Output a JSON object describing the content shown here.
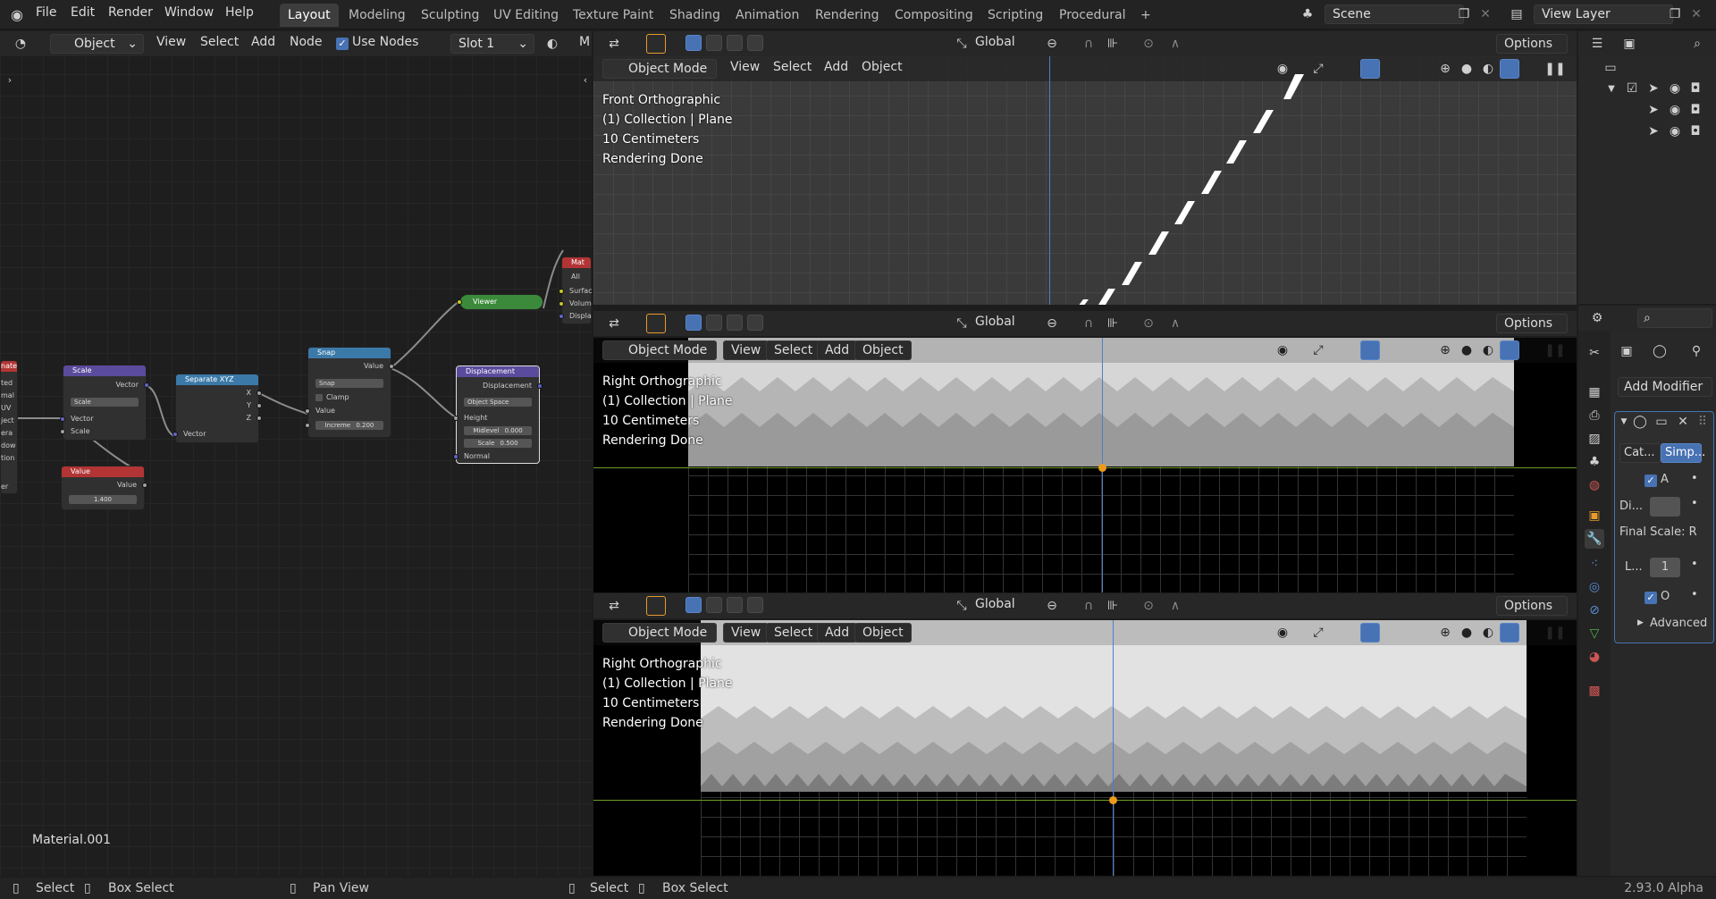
{
  "menus": [
    "File",
    "Edit",
    "Render",
    "Window",
    "Help"
  ],
  "workspaces": [
    "Layout",
    "Modeling",
    "Sculpting",
    "UV Editing",
    "Texture Paint",
    "Shading",
    "Animation",
    "Rendering",
    "Compositing",
    "Scripting",
    "Procedural"
  ],
  "add_workspace": "+",
  "scene": "Scene",
  "view_layer": "View Layer",
  "node_editor": {
    "object_dropdown": "Object",
    "menus": [
      "View",
      "Select",
      "Add",
      "Node"
    ],
    "use_nodes_label": "Use Nodes",
    "slot": "Slot 1",
    "material_name": "Material.001",
    "nodes": {
      "scale": {
        "title": "Scale",
        "out": "Vector",
        "mode": "Scale",
        "in1": "Vector",
        "in2": "Scale"
      },
      "value": {
        "title": "Value",
        "out": "Value",
        "val": "1.400"
      },
      "separate": {
        "title": "Separate XYZ",
        "x": "X",
        "y": "Y",
        "z": "Z",
        "in": "Vector"
      },
      "snap": {
        "title": "Snap",
        "out": "Value",
        "mode": "Snap",
        "clamp": "Clamp",
        "in": "Value",
        "increment_label": "Increme",
        "increment": "0.200"
      },
      "viewer": {
        "title": "Viewer"
      },
      "displacement": {
        "title": "Displacement",
        "out": "Displacement",
        "space": "Object Space",
        "height": "Height",
        "midlevel_label": "Midlevel",
        "midlevel": "0.000",
        "scale_label": "Scale",
        "scale": "0.500",
        "normal": "Normal"
      },
      "material_output": {
        "title": "Mat",
        "all": "All",
        "surface": "Surfac",
        "volume": "Volum",
        "displacement": "Displa"
      },
      "left_node_title": "nate",
      "left_node_rows": [
        "ted",
        "mal",
        "UV",
        "ject",
        "era",
        "dow",
        "tion",
        "er"
      ]
    }
  },
  "viewport_header": {
    "transform": "Global",
    "options": "Options",
    "mode": "Object Mode",
    "menus": [
      "View",
      "Select",
      "Add",
      "Object"
    ]
  },
  "viewports": [
    {
      "lines": [
        "Front Orthographic",
        "(1) Collection | Plane",
        "10 Centimeters",
        "Rendering Done"
      ]
    },
    {
      "lines": [
        "Right Orthographic",
        "(1) Collection | Plane",
        "10 Centimeters",
        "Rendering Done"
      ]
    },
    {
      "lines": [
        "Right Orthographic",
        "(1) Collection | Plane",
        "10 Centimeters",
        "Rendering Done"
      ]
    }
  ],
  "properties": {
    "add_modifier": "Add Modifier",
    "tab_catmull": "Cat...",
    "tab_simple": "Simp...",
    "check_a": "A",
    "di_label": "Di...",
    "final_scale": "Final Scale: R",
    "levels_label": "L...",
    "levels_value": "1",
    "check_o": "O",
    "advanced": "Advanced"
  },
  "status": {
    "select1": "Select",
    "box1": "Box Select",
    "pan": "Pan View",
    "select2": "Select",
    "box2": "Box Select",
    "version": "2.93.0 Alpha"
  },
  "colors": {
    "accent": "#4772b3",
    "header": "#232323",
    "orange": "#e69b2e"
  }
}
